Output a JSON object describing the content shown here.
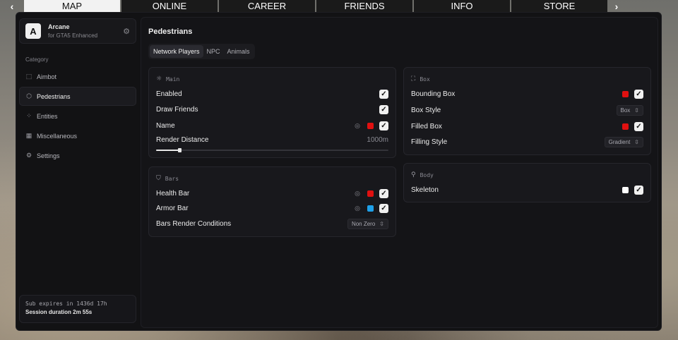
{
  "topbar": {
    "left_arrow": "‹",
    "right_arrow": "›",
    "tabs": [
      {
        "label": "MAP",
        "active": true
      },
      {
        "label": "ONLINE",
        "active": false
      },
      {
        "label": "CAREER",
        "active": false
      },
      {
        "label": "FRIENDS",
        "active": false
      },
      {
        "label": "INFO",
        "active": false
      },
      {
        "label": "STORE",
        "active": false
      }
    ]
  },
  "brand": {
    "logo": "A",
    "name": "Arcane",
    "subtitle": "for GTA5 Enhanced",
    "icon": "gear-icon"
  },
  "sidebar": {
    "category_label": "Category",
    "items": [
      {
        "label": "Aimbot",
        "icon": "crosshair-icon",
        "glyph": "⬚",
        "active": false
      },
      {
        "label": "Pedestrians",
        "icon": "cube-icon",
        "glyph": "⬡",
        "active": true
      },
      {
        "label": "Entities",
        "icon": "entities-icon",
        "glyph": "⁘",
        "active": false
      },
      {
        "label": "Miscellaneous",
        "icon": "grid-icon",
        "glyph": "▦",
        "active": false
      },
      {
        "label": "Settings",
        "icon": "gear-icon",
        "glyph": "⚙",
        "active": false
      }
    ],
    "subscription": {
      "expires": "Sub expires in 1436d 17h",
      "session": "Session duration  2m 55s"
    }
  },
  "content": {
    "title": "Pedestrians",
    "subtabs": [
      {
        "label": "Network Players",
        "active": true
      },
      {
        "label": "NPC",
        "active": false
      },
      {
        "label": "Animals",
        "active": false
      }
    ]
  },
  "main_card": {
    "title": "Main",
    "enabled": {
      "label": "Enabled",
      "checked": true
    },
    "draw_friends": {
      "label": "Draw Friends",
      "checked": true
    },
    "name": {
      "label": "Name",
      "color": "#e01010",
      "checked": true
    },
    "render_distance": {
      "label": "Render Distance",
      "value": "1000m",
      "fraction": 0.1
    }
  },
  "bars_card": {
    "title": "Bars",
    "health_bar": {
      "label": "Health Bar",
      "color": "#e01010",
      "checked": true
    },
    "armor_bar": {
      "label": "Armor Bar",
      "color": "#1ea0e8",
      "checked": true
    },
    "conditions": {
      "label": "Bars Render Conditions",
      "value": "Non Zero"
    }
  },
  "box_card": {
    "title": "Box",
    "bounding_box": {
      "label": "Bounding Box",
      "color": "#e01010",
      "checked": true
    },
    "box_style": {
      "label": "Box Style",
      "value": "Box"
    },
    "filled_box": {
      "label": "Filled Box",
      "color": "#e01010",
      "checked": true
    },
    "filling_style": {
      "label": "Filling Style",
      "value": "Gradient"
    }
  },
  "body_card": {
    "title": "Body",
    "skeleton": {
      "label": "Skeleton",
      "color": "#ffffff",
      "checked": true
    }
  },
  "glyphs": {
    "check": "✓",
    "target": "◎",
    "select": "⇳",
    "sun": "☼",
    "shield": "⛉",
    "box": "⛶",
    "link": "⚲"
  }
}
